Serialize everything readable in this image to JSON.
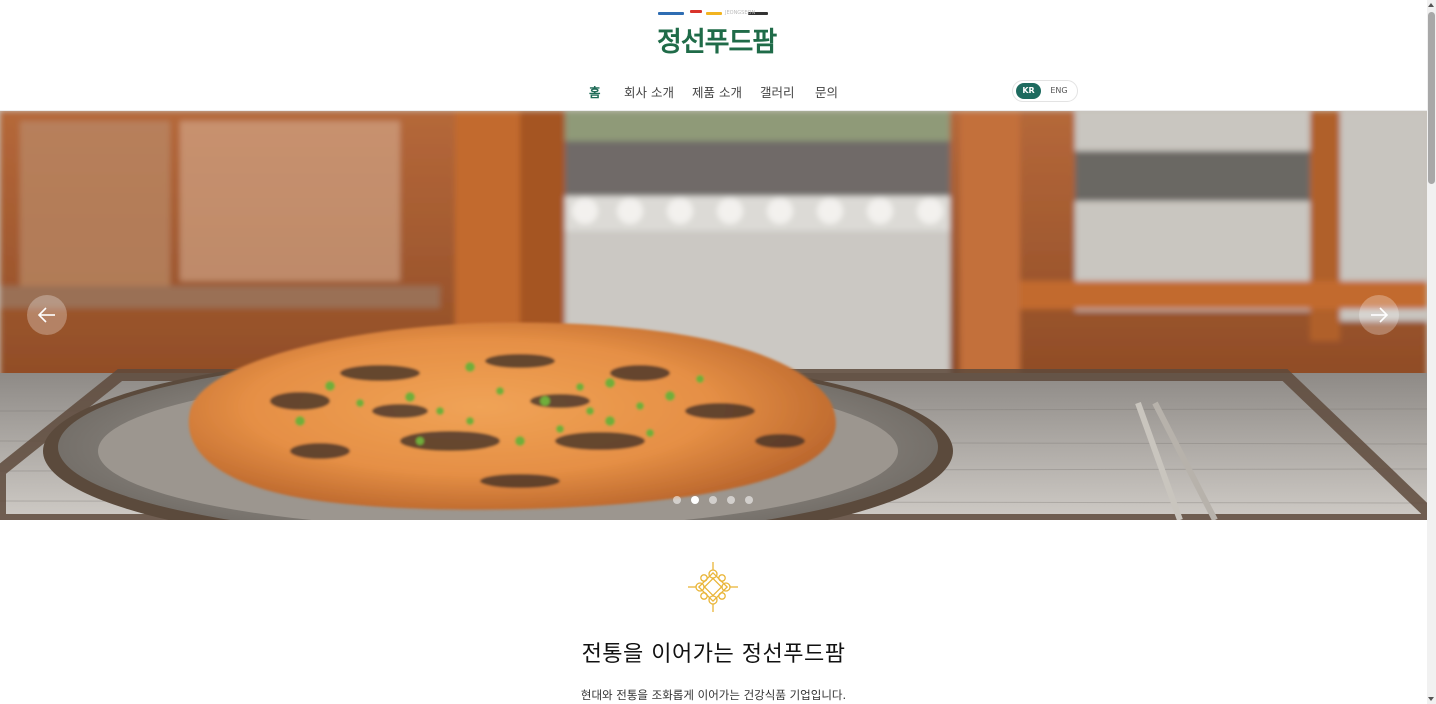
{
  "logo": {
    "text": "정선푸드팜",
    "small_text": "JEONGSEON",
    "stripe_colors": [
      "#2e6db3",
      "#d9342b",
      "#f2b420",
      "#1f6b48",
      "#333333"
    ]
  },
  "nav": {
    "items": [
      {
        "label": "홈",
        "active": true
      },
      {
        "label": "회사 소개",
        "active": false
      },
      {
        "label": "제품 소개",
        "active": false
      },
      {
        "label": "갤러리",
        "active": false
      },
      {
        "label": "문의",
        "active": false
      }
    ],
    "lang": {
      "kr": "KR",
      "en": "ENG",
      "selected": "KR"
    }
  },
  "hero": {
    "image": "kimchi-pancake-on-wooden-plate",
    "slide_count": 5,
    "active_slide": 2,
    "prev_icon": "arrow-left-icon",
    "next_icon": "arrow-right-icon"
  },
  "intro": {
    "ornament_icon": "knot-ornament-icon",
    "title": "전통을 이어가는 정선푸드팜",
    "subtitle": "현대와 전통을 조화롭게 이어가는 건강식품 기업입니다."
  },
  "colors": {
    "brand_green": "#1f6b48",
    "accent_teal": "#1e6b5f",
    "ornament_gold": "#e9b538"
  }
}
